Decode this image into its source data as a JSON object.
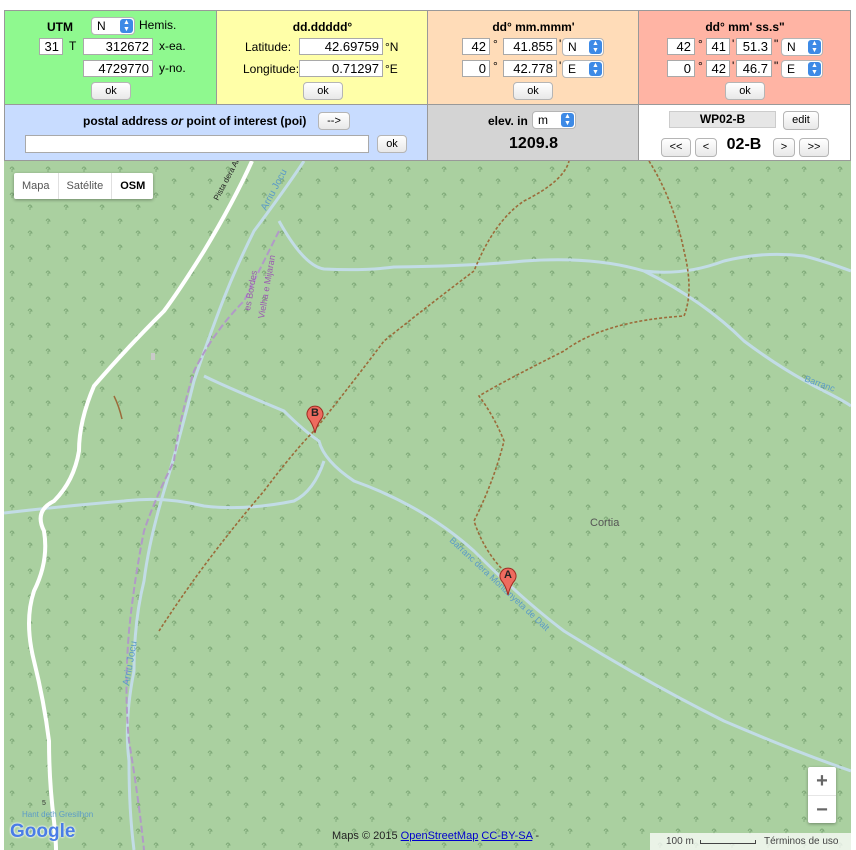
{
  "utm": {
    "title": "UTM",
    "hemis_value": "N",
    "hemis_label": "Hemis.",
    "zone": "31",
    "band": "T",
    "easting": "312672",
    "easting_label": "x-ea.",
    "northing": "4729770",
    "northing_label": "y-no.",
    "ok_label": "ok"
  },
  "decimal": {
    "title": "dd.ddddd°",
    "lat_label": "Latitude:",
    "lat_value": "42.69759",
    "lat_unit": "°N",
    "lon_label": "Longitude:",
    "lon_value": "0.71297",
    "lon_unit": "°E",
    "ok_label": "ok"
  },
  "dm": {
    "title": "dd° mm.mmm'",
    "lat_deg": "42",
    "lat_min": "41.855",
    "lat_hemi": "N",
    "lon_deg": "0",
    "lon_min": "42.778",
    "lon_hemi": "E",
    "deg_sym": "°",
    "min_sym": "'",
    "ok_label": "ok"
  },
  "dms": {
    "title": "dd° mm' ss.s\"",
    "lat_deg": "42",
    "lat_min": "41",
    "lat_sec": "51.3",
    "lat_hemi": "N",
    "lon_deg": "0",
    "lon_min": "42",
    "lon_sec": "46.7",
    "lon_hemi": "E",
    "deg_sym": "°",
    "min_sym": "'",
    "sec_sym": "\"",
    "ok_label": "ok"
  },
  "address": {
    "title_a": "postal address",
    "title_or": "or",
    "title_b": "point of interest (poi)",
    "go_label": "-->",
    "value": "",
    "ok_label": "ok"
  },
  "elevation": {
    "label": "elev. in",
    "unit": "m",
    "value": "1209.8"
  },
  "waypoint": {
    "name": "WP02-B",
    "edit_label": "edit",
    "first_label": "<<",
    "prev_label": "<",
    "current": "02-B",
    "next_label": ">",
    "last_label": ">>"
  },
  "map": {
    "type_buttons": [
      "Mapa",
      "Satélite",
      "OSM"
    ],
    "active_type": "OSM",
    "labels": {
      "road": "Pista dera Artiga",
      "river_north": "Arriu Jocu",
      "river_south": "Arriu Jocu",
      "bordes_a": "es Bordes",
      "bordes_b": "Vielha e Mijaran",
      "cortia": "Cortia",
      "barranc": "Barranc dera Montanyeta de Dalt",
      "barranc_edge": "Barranc",
      "bottom_left": "Hant deth Gresilhon",
      "road_number": "5"
    },
    "markers": [
      "A",
      "B"
    ],
    "zoom_in": "+",
    "zoom_out": "−",
    "google_logo": "Google",
    "attribution_prefix": "Maps © 2015",
    "attribution_link1": "OpenStreetMap",
    "attribution_link2": "CC-BY-SA",
    "attribution_suffix": "-",
    "scale_label": "100 m",
    "terms": "Términos de uso"
  },
  "colors": {
    "utm_bg": "#8ff98f",
    "decimal_bg": "#ffffa8",
    "dm_bg": "#ffdcb8",
    "dms_bg": "#ffb4a4",
    "address_bg": "#c8dcff",
    "elev_bg": "#d4d4d4",
    "wp_bg": "#ffffff",
    "map_bg": "#aad0a0",
    "marker": "#ee6b5f"
  }
}
